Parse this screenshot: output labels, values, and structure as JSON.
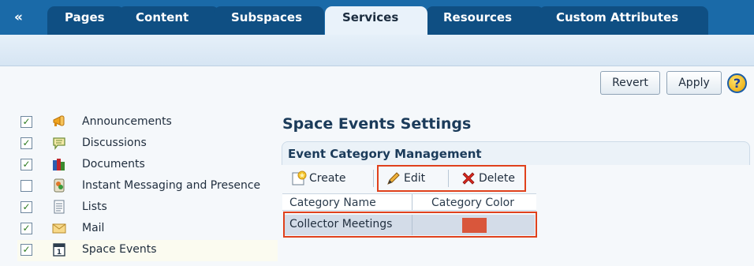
{
  "tabbar": {
    "collapse_icon": "double-chevron-left-icon",
    "tabs": [
      {
        "label": "Pages",
        "active": false
      },
      {
        "label": "Content",
        "active": false
      },
      {
        "label": "Subspaces",
        "active": false
      },
      {
        "label": "Services",
        "active": true
      },
      {
        "label": "Resources",
        "active": false
      },
      {
        "label": "Custom Attributes",
        "active": false
      }
    ]
  },
  "actions": {
    "revert_label": "Revert",
    "apply_label": "Apply",
    "help_label": "?"
  },
  "services": [
    {
      "label": "Announcements",
      "checked": true,
      "icon": "megaphone-icon"
    },
    {
      "label": "Discussions",
      "checked": true,
      "icon": "speech-bubble-icon"
    },
    {
      "label": "Documents",
      "checked": true,
      "icon": "documents-icon"
    },
    {
      "label": "Instant Messaging and Presence",
      "checked": false,
      "icon": "instant-messaging-icon"
    },
    {
      "label": "Lists",
      "checked": true,
      "icon": "list-icon"
    },
    {
      "label": "Mail",
      "checked": true,
      "icon": "mail-icon"
    },
    {
      "label": "Space Events",
      "checked": true,
      "icon": "calendar-icon",
      "selected": true
    }
  ],
  "settings": {
    "title": "Space Events Settings",
    "section_title": "Event Category Management",
    "toolbar": {
      "create_label": "Create",
      "edit_label": "Edit",
      "delete_label": "Delete"
    },
    "table": {
      "columns": [
        "Category Name",
        "Category Color"
      ],
      "rows": [
        {
          "name": "Collector Meetings",
          "color": "#d9563b"
        }
      ]
    }
  },
  "colors": {
    "tab_bar": "#1a6aa8",
    "tab": "#0f4f83",
    "highlight_box": "#e0411c"
  }
}
